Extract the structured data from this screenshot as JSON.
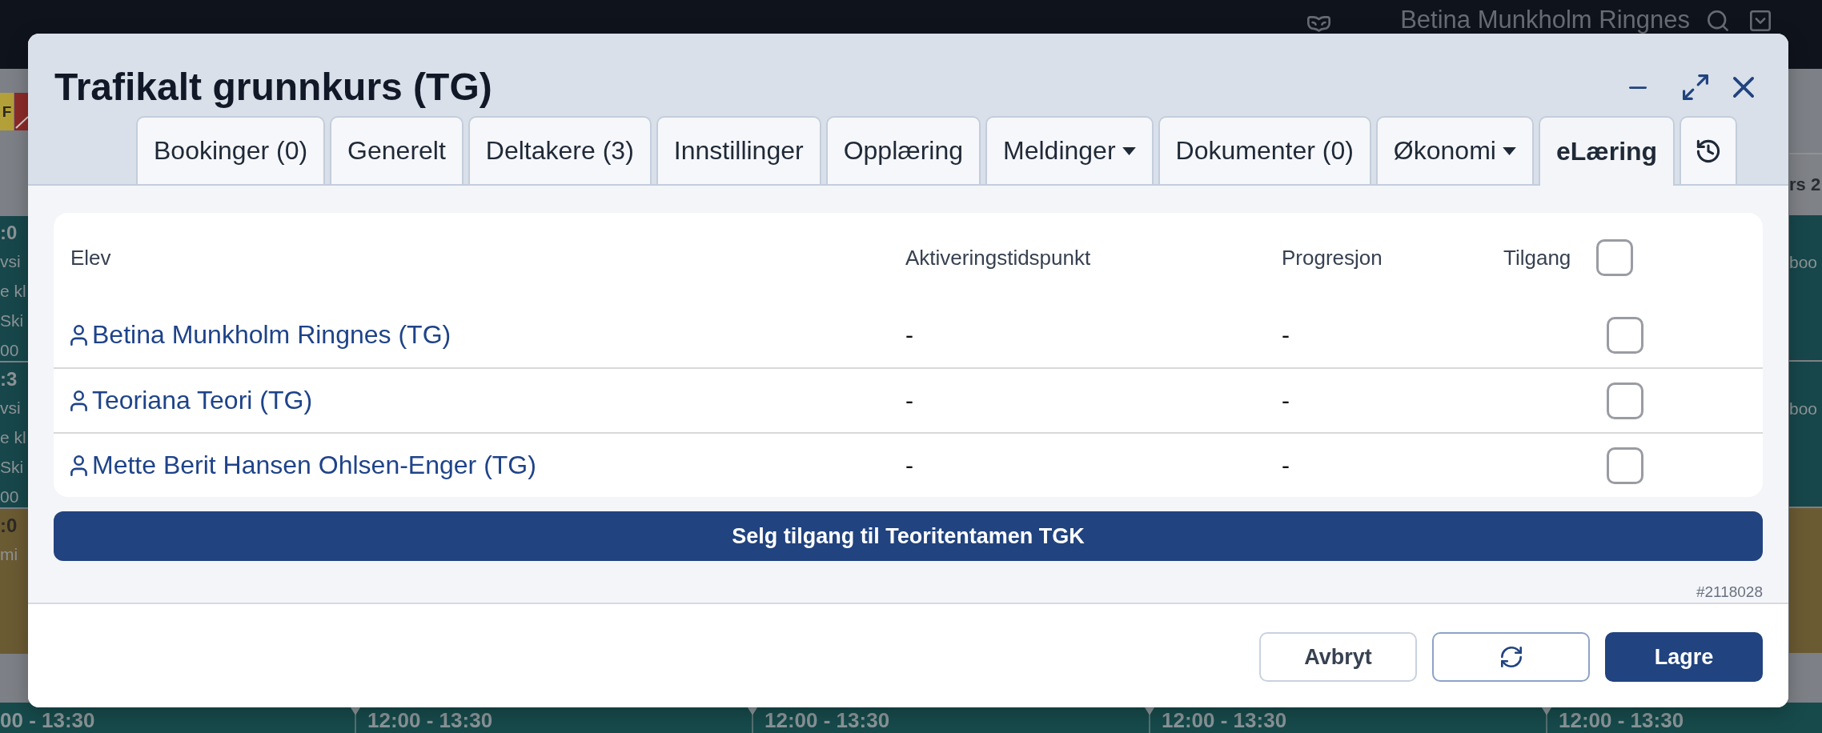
{
  "top_bar": {
    "user_name": "Betina Munkholm Ringnes"
  },
  "calendar": {
    "left_column": {
      "badge": "F",
      "events": [
        {
          "color": "#17474b",
          "time": ":0",
          "lines": [
            "vsi",
            "e kl",
            "Ski",
            "00"
          ]
        },
        {
          "color": "#17474b",
          "time": ":3",
          "lines": [
            "vsi",
            "e kl",
            "Ski",
            "00"
          ]
        },
        {
          "color": "#6b5b33",
          "time": ":0",
          "lines": [
            "mi"
          ]
        }
      ]
    },
    "right_column": {
      "header": "rs 2",
      "events": [
        {
          "color": "#17474b",
          "lines": [
            "boo"
          ]
        },
        {
          "color": "#17474b",
          "lines": [
            "boo"
          ]
        },
        {
          "color": "#6b5b33"
        }
      ]
    },
    "time_slots": [
      "00 - 13:30",
      "12:00 - 13:30",
      "12:00 - 13:30",
      "12:00 - 13:30",
      "12:00 - 13:30"
    ]
  },
  "dialog": {
    "title": "Trafikalt grunnkurs (TG)",
    "tabs": [
      {
        "kind": "text",
        "label": "Bookinger (0)",
        "selected": false
      },
      {
        "kind": "text",
        "label": "Generelt",
        "selected": false
      },
      {
        "kind": "text",
        "label": "Deltakere (3)",
        "selected": false
      },
      {
        "kind": "text",
        "label": "Innstillinger",
        "selected": false
      },
      {
        "kind": "text",
        "label": "Opplæring",
        "selected": false
      },
      {
        "kind": "dropdown",
        "label": "Meldinger",
        "selected": false
      },
      {
        "kind": "text",
        "label": "Dokumenter (0)",
        "selected": false
      },
      {
        "kind": "dropdown",
        "label": "Økonomi",
        "selected": false
      },
      {
        "kind": "text",
        "label": "eLæring",
        "selected": true
      },
      {
        "kind": "history",
        "selected": false
      }
    ],
    "table": {
      "columns": [
        "Elev",
        "Aktiveringstidspunkt",
        "Progresjon",
        "Tilgang"
      ],
      "select_all_checked": false,
      "rows": [
        {
          "name": "Betina Munkholm Ringnes (TG)",
          "activation": "-",
          "progress": "-",
          "access_checked": false
        },
        {
          "name": "Teoriana Teori (TG)",
          "activation": "-",
          "progress": "-",
          "access_checked": false
        },
        {
          "name": "Mette Berit Hansen Ohlsen-Enger (TG)",
          "activation": "-",
          "progress": "-",
          "access_checked": false
        }
      ]
    },
    "sell_button": "Selg tilgang til Teoritentamen TGK",
    "record_id": "#2118028",
    "footer_buttons": [
      {
        "kind": "secondary",
        "label": "Avbryt"
      },
      {
        "kind": "refresh"
      },
      {
        "kind": "primary",
        "label": "Lagre"
      }
    ]
  }
}
